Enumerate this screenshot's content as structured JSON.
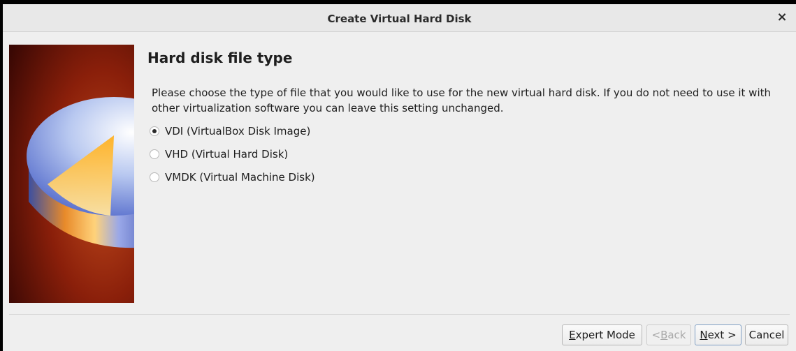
{
  "window": {
    "title": "Create Virtual Hard Disk",
    "close_glyph": "×"
  },
  "page": {
    "title": "Hard disk file type",
    "description": "Please choose the type of file that you would like to use for the new virtual hard disk. If you do not need to use it with other virtualization software you can leave this setting unchanged."
  },
  "options": [
    {
      "label": "VDI (VirtualBox Disk Image)",
      "checked": true
    },
    {
      "label": "VHD (Virtual Hard Disk)",
      "checked": false
    },
    {
      "label": "VMDK (Virtual Machine Disk)",
      "checked": false
    }
  ],
  "buttons": {
    "expert": {
      "mnemonic": "E",
      "rest": "xpert Mode"
    },
    "back": {
      "prefix": "< ",
      "mnemonic": "B",
      "rest": "ack",
      "enabled": false
    },
    "next": {
      "mnemonic": "N",
      "rest": "ext >"
    },
    "cancel": {
      "label": "Cancel"
    }
  },
  "icons": {
    "close": "close-icon",
    "wizard": "hard-disk-illustration"
  }
}
